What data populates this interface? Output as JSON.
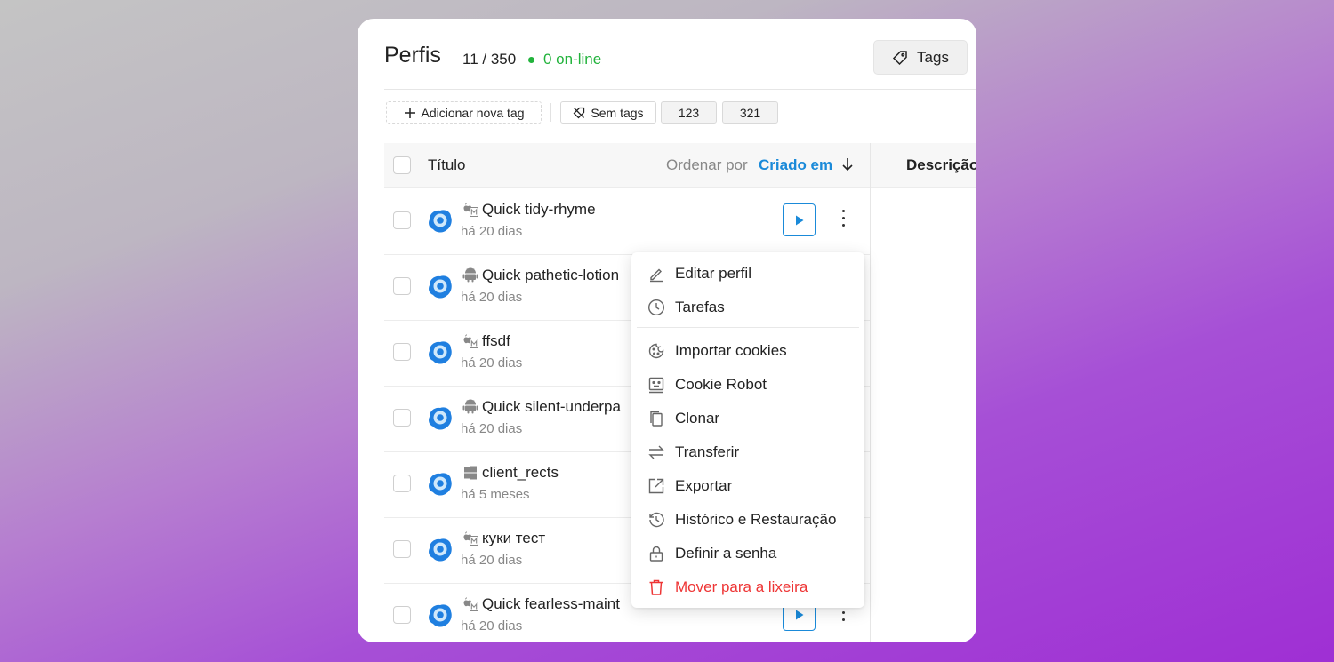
{
  "header": {
    "title": "Perfis",
    "count": "11 / 350",
    "online": "0 on-line",
    "tags_button": "Tags"
  },
  "tagbar": {
    "add": "Adicionar nova tag",
    "no_tags": "Sem tags",
    "tags": [
      "123",
      "321"
    ]
  },
  "table": {
    "col_title": "Título",
    "order_by": "Ordenar por",
    "sort_key": "Criado em",
    "col_desc": "Descrição",
    "rows": [
      {
        "name": "Quick tidy-rhyme",
        "date": "há 20 dias",
        "os": "macos"
      },
      {
        "name": "Quick pathetic-lotion",
        "date": "há 20 dias",
        "os": "android"
      },
      {
        "name": "ffsdf",
        "date": "há 20 dias",
        "os": "macos"
      },
      {
        "name": "Quick silent-underpa",
        "date": "há 20 dias",
        "os": "android"
      },
      {
        "name": "client_rects",
        "date": "há 5 meses",
        "os": "windows"
      },
      {
        "name": "куки тест",
        "date": "há 20 dias",
        "os": "macos"
      },
      {
        "name": "Quick fearless-maint",
        "date": "há 20 dias",
        "os": "macos"
      }
    ]
  },
  "menu": {
    "items": [
      {
        "label": "Editar perfil",
        "icon": "pencil-icon"
      },
      {
        "label": "Tarefas",
        "icon": "clock-icon"
      },
      {
        "label": "Importar cookies",
        "icon": "cookie-icon"
      },
      {
        "label": "Cookie Robot",
        "icon": "robot-icon"
      },
      {
        "label": "Clonar",
        "icon": "copy-icon"
      },
      {
        "label": "Transferir",
        "icon": "transfer-icon"
      },
      {
        "label": "Exportar",
        "icon": "export-icon"
      },
      {
        "label": "Histórico e Restauração",
        "icon": "history-icon"
      },
      {
        "label": "Definir a senha",
        "icon": "lock-icon"
      },
      {
        "label": "Mover para a lixeira",
        "icon": "trash-icon"
      }
    ]
  },
  "colors": {
    "accent": "#1a8ad9",
    "online": "#22b33c",
    "danger": "#ee3535"
  }
}
